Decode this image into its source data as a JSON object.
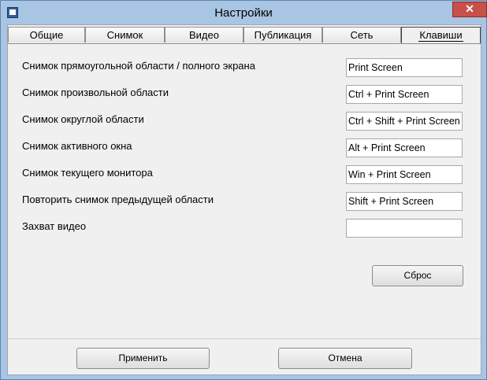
{
  "window": {
    "title": "Настройки",
    "close_glyph": "✕"
  },
  "tabs": [
    {
      "label": "Общие"
    },
    {
      "label": "Снимок"
    },
    {
      "label": "Видео"
    },
    {
      "label": "Публикация"
    },
    {
      "label": "Сеть"
    },
    {
      "label": "Клавиши",
      "active": true
    }
  ],
  "hotkeys": [
    {
      "label": "Снимок прямоугольной области / полного экрана",
      "value": "Print Screen"
    },
    {
      "label": "Снимок произвольной области",
      "value": "Ctrl + Print Screen"
    },
    {
      "label": "Снимок округлой области",
      "value": "Ctrl + Shift + Print Screen"
    },
    {
      "label": "Снимок активного окна",
      "value": "Alt + Print Screen"
    },
    {
      "label": "Снимок текущего монитора",
      "value": "Win + Print Screen"
    },
    {
      "label": "Повторить снимок предыдущей области",
      "value": "Shift + Print Screen"
    },
    {
      "label": "Захват видео",
      "value": ""
    }
  ],
  "buttons": {
    "reset": "Сброс",
    "apply": "Применить",
    "cancel": "Отмена"
  }
}
